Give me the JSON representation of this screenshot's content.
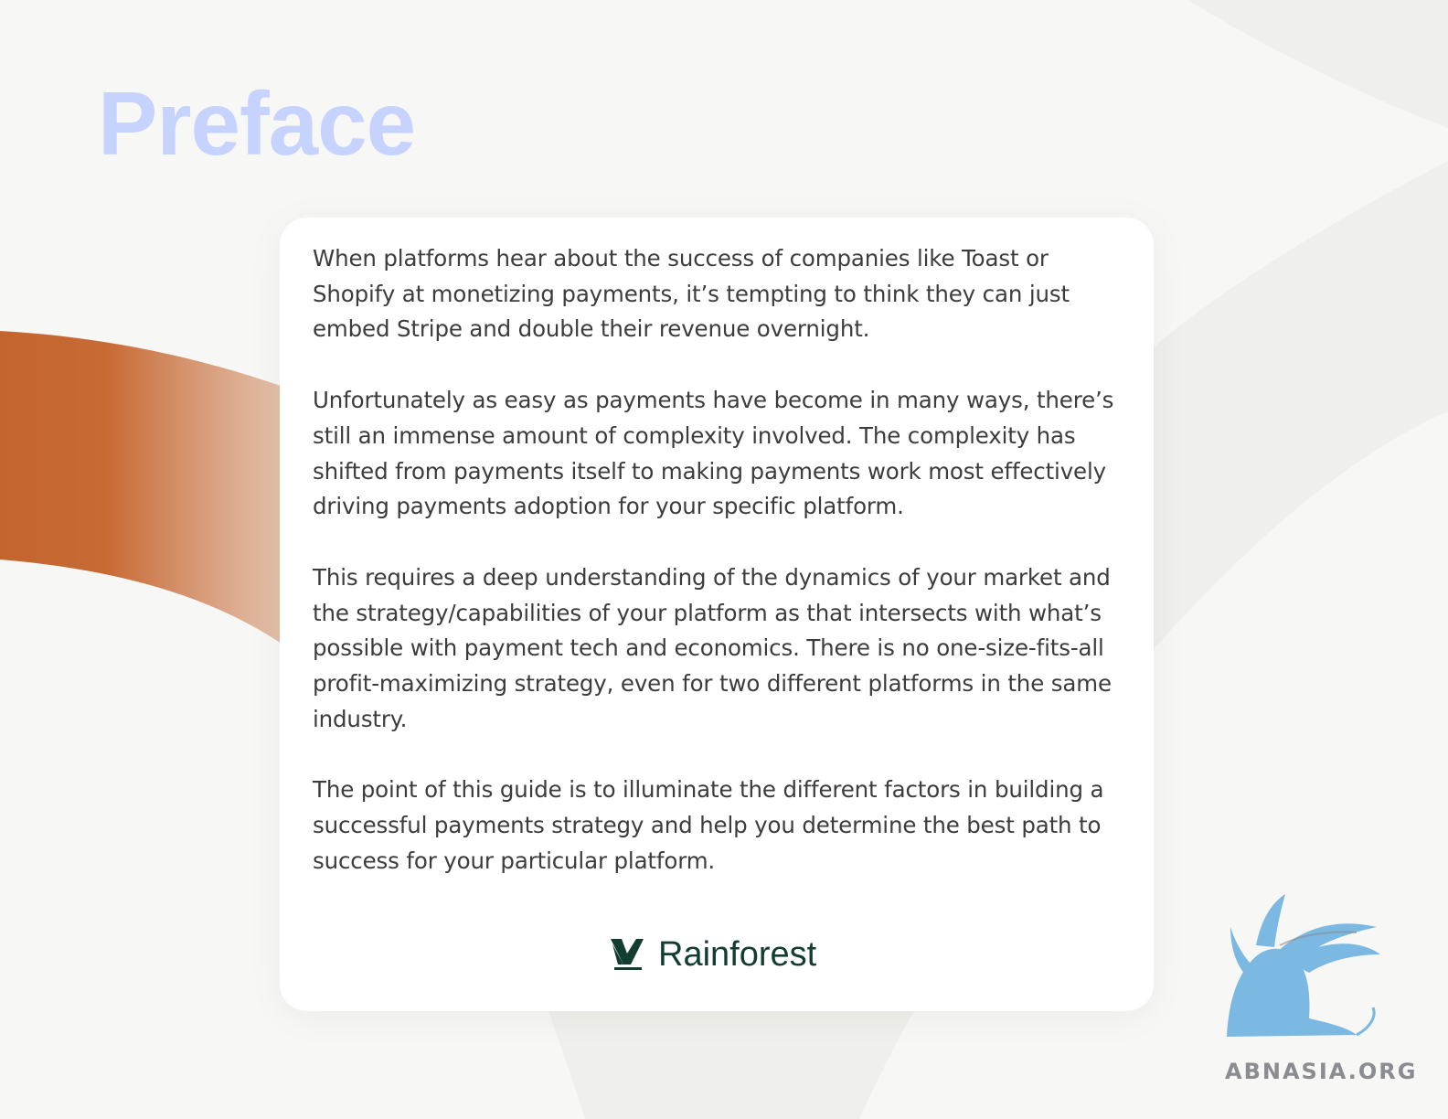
{
  "page": {
    "title": "Preface",
    "paragraphs": [
      "When platforms hear about the success of companies like Toast or Shopify at monetizing payments, it’s tempting to think they can just embed Stripe and double their revenue overnight.",
      "Unfortunately as easy as payments have become in many ways, there’s still an immense amount of complexity involved. The complexity has shifted from payments itself to making payments work most effectively driving payments adoption for your specific platform.",
      "This requires a deep understanding of the dynamics of your market and the strategy/capabilities of your platform as that intersects with what’s possible with payment tech and economics. There is no one-size-fits-all profit-maximizing strategy, even for two different platforms in the same industry.",
      "The point of this guide is to illuminate the different factors in building a successful payments strategy and help you determine the best path to success for your particular platform."
    ]
  },
  "brand": {
    "name": "Rainforest",
    "icon": "rainforest-leaf-icon",
    "color": "#123d30"
  },
  "watermark": {
    "text": "ABNASIA.ORG",
    "icon": "griffin-logo-icon"
  },
  "colors": {
    "title": "#c7d3ff",
    "accent_orange": "#c4652f",
    "background": "#f7f7f5"
  }
}
